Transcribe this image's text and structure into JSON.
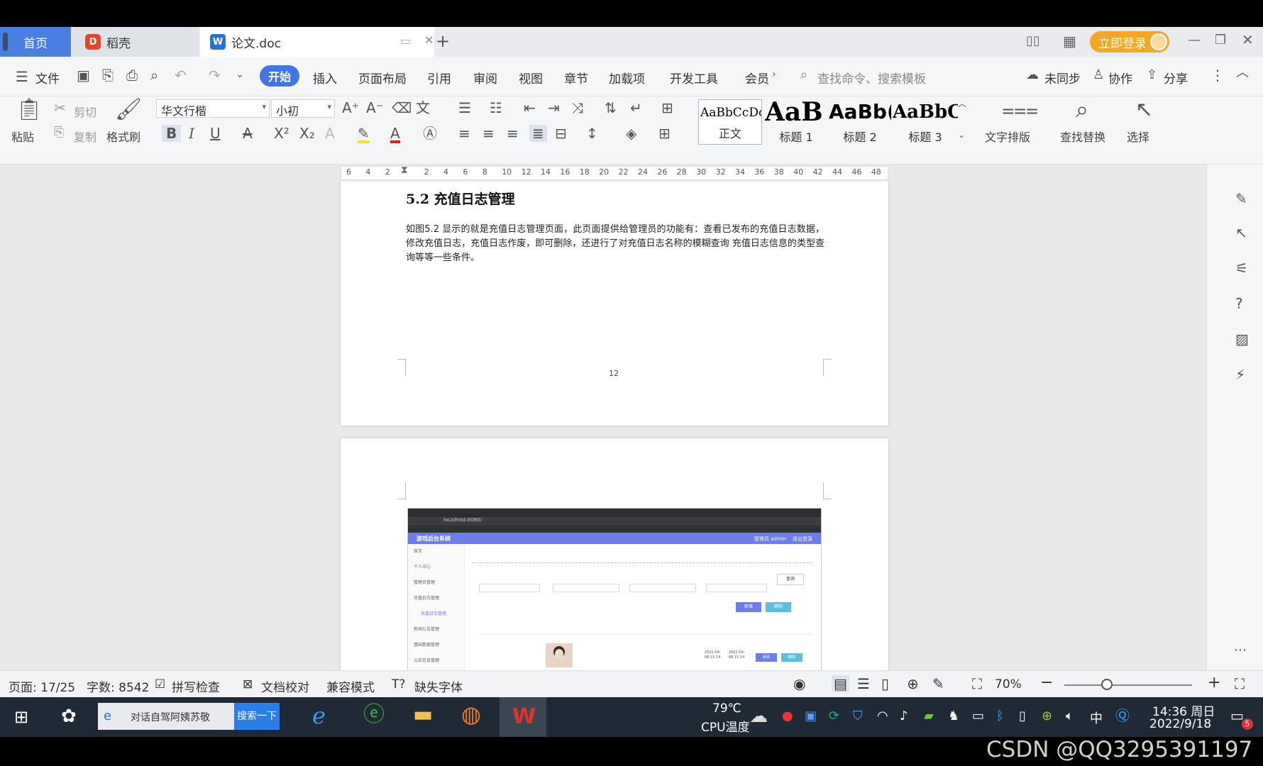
{
  "tabs": {
    "home": "首页",
    "daoke": "稻壳",
    "doc": "论文.doc",
    "login": "立即登录"
  },
  "menu": {
    "file": "文件",
    "items": [
      "开始",
      "插入",
      "页面布局",
      "引用",
      "审阅",
      "视图",
      "章节",
      "加载项",
      "开发工具",
      "会员"
    ],
    "search_placeholder": "查找命令、搜索模板",
    "unsynced": "未同步",
    "collab": "协作",
    "share": "分享"
  },
  "ribbon": {
    "paste": "粘贴",
    "cut": "剪切",
    "copy": "复制",
    "format_painter": "格式刷",
    "font_name": "华文行楷",
    "font_size": "小初",
    "styles": [
      {
        "preview": "AaBbCcDc",
        "label": "正文"
      },
      {
        "preview": "AaB",
        "label": "标题 1"
      },
      {
        "preview": "AaBb(",
        "label": "标题 2"
      },
      {
        "preview": "AaBbC",
        "label": "标题 3"
      }
    ],
    "text_layout": "文字排版",
    "find_replace": "查找替换",
    "select": "选择"
  },
  "ruler": {
    "ticks": [
      "6",
      "4",
      "2",
      "",
      "2",
      "4",
      "6",
      "8",
      "10",
      "12",
      "14",
      "16",
      "18",
      "20",
      "22",
      "24",
      "26",
      "28",
      "30",
      "32",
      "34",
      "36",
      "38",
      "40",
      "42",
      "44",
      "46",
      "48"
    ]
  },
  "document": {
    "heading": "5.2  充值日志管理",
    "paragraph": "如图5.2 显示的就是充值日志管理页面，此页面提供给管理员的功能有：查看已发布的充值日志数据，修改充值日志，充值日志作废，即可删除，还进行了对充值日志名称的模糊查询 充值日志信息的类型查询等等一些条件。",
    "page_number": "12",
    "screenshot": {
      "app_title": "游戏后台系统",
      "user": "管理员 admin",
      "logout": "退出登录",
      "url": "localhost:8080/",
      "sidebar": [
        "首页",
        "个人中心",
        "管理员管理",
        "充值日志管理",
        "充值日志管理",
        "新闻公告管理",
        "基础数据管理",
        "公告信息管理"
      ],
      "search_btn": "查询",
      "add_btn": "新增",
      "del_btn": "删除",
      "row_date1": "2022-04-08 15:14",
      "row_date2": "2022-04-08 15:14",
      "edit_btn": "修改",
      "delete_btn": "删除"
    }
  },
  "status": {
    "page": "页面: 17/25",
    "words": "字数: 8542",
    "spell": "拼写检查",
    "proof": "文档校对",
    "compat": "兼容模式",
    "missing_font": "缺失字体",
    "zoom": "70%"
  },
  "taskbar": {
    "search_text": "对话自驾阿姨苏敬",
    "search_button": "搜索一下",
    "temp": "79℃",
    "temp_label": "CPU温度",
    "ime": "中",
    "time": "14:36 周日",
    "date": "2022/9/18",
    "notif_count": "5"
  },
  "watermark": "CSDN @QQ3295391197"
}
